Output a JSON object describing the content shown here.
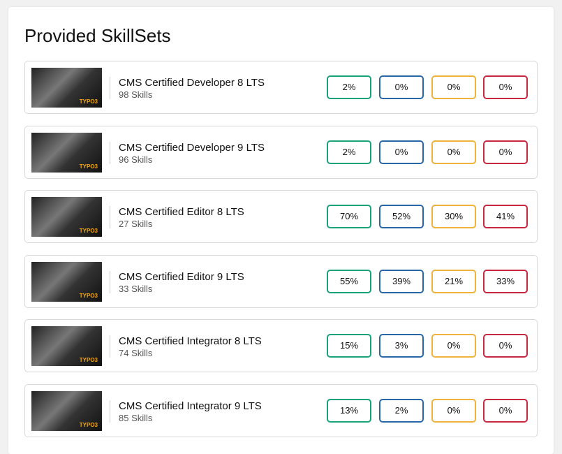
{
  "title": "Provided SkillSets",
  "colors": [
    "#1aa37a",
    "#2767a8",
    "#f0b23a",
    "#c8283f"
  ],
  "items": [
    {
      "name": "CMS Certified Developer 8 LTS",
      "skills": "98 Skills",
      "logo": "TYPO3",
      "stats": [
        "2%",
        "0%",
        "0%",
        "0%"
      ]
    },
    {
      "name": "CMS Certified Developer 9 LTS",
      "skills": "96 Skills",
      "logo": "TYPO3",
      "stats": [
        "2%",
        "0%",
        "0%",
        "0%"
      ]
    },
    {
      "name": "CMS Certified Editor 8 LTS",
      "skills": "27 Skills",
      "logo": "TYPO3",
      "stats": [
        "70%",
        "52%",
        "30%",
        "41%"
      ]
    },
    {
      "name": "CMS Certified Editor 9 LTS",
      "skills": "33 Skills",
      "logo": "TYPO3",
      "stats": [
        "55%",
        "39%",
        "21%",
        "33%"
      ]
    },
    {
      "name": "CMS Certified Integrator 8 LTS",
      "skills": "74 Skills",
      "logo": "TYPO3",
      "stats": [
        "15%",
        "3%",
        "0%",
        "0%"
      ]
    },
    {
      "name": "CMS Certified Integrator 9 LTS",
      "skills": "85 Skills",
      "logo": "TYPO3",
      "stats": [
        "13%",
        "2%",
        "0%",
        "0%"
      ]
    }
  ]
}
